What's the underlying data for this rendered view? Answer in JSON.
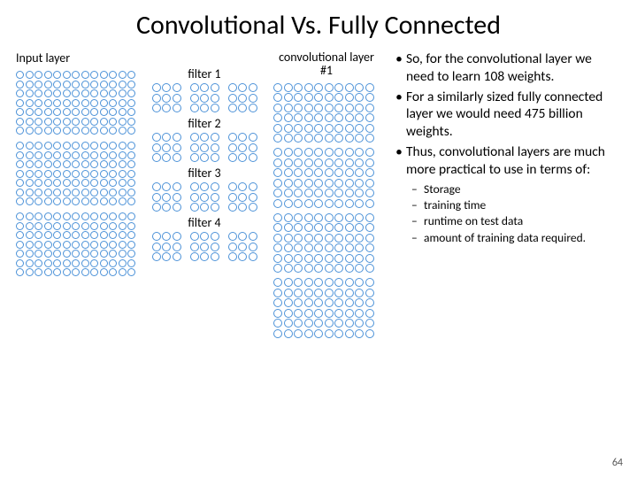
{
  "title": "Convolutional Vs. Fully Connected",
  "input_label": "Input layer",
  "filters": [
    "filter 1",
    "filter 2",
    "filter 3",
    "filter 4"
  ],
  "conv_label": "convolutional layer #1",
  "bullets": [
    "So, for the convolutional layer we need to learn 108 weights.",
    "For a similarly sized fully connected layer we would need 475 billion weights.",
    "Thus, convolutional layers are much more practical to use in terms of:"
  ],
  "sub_bullets": [
    "Storage",
    "training time",
    "runtime on test data",
    "amount of training data required."
  ],
  "slide_number": "64",
  "chart_data": {
    "type": "diagram",
    "input_grid": {
      "rows": 7,
      "cols": 13,
      "count": 3
    },
    "filter_grid": {
      "rows": 3,
      "cols": 3,
      "groups_per_filter": 3,
      "filters": 4
    },
    "conv_grid": {
      "rows": 6,
      "cols": 10,
      "count": 4
    }
  }
}
